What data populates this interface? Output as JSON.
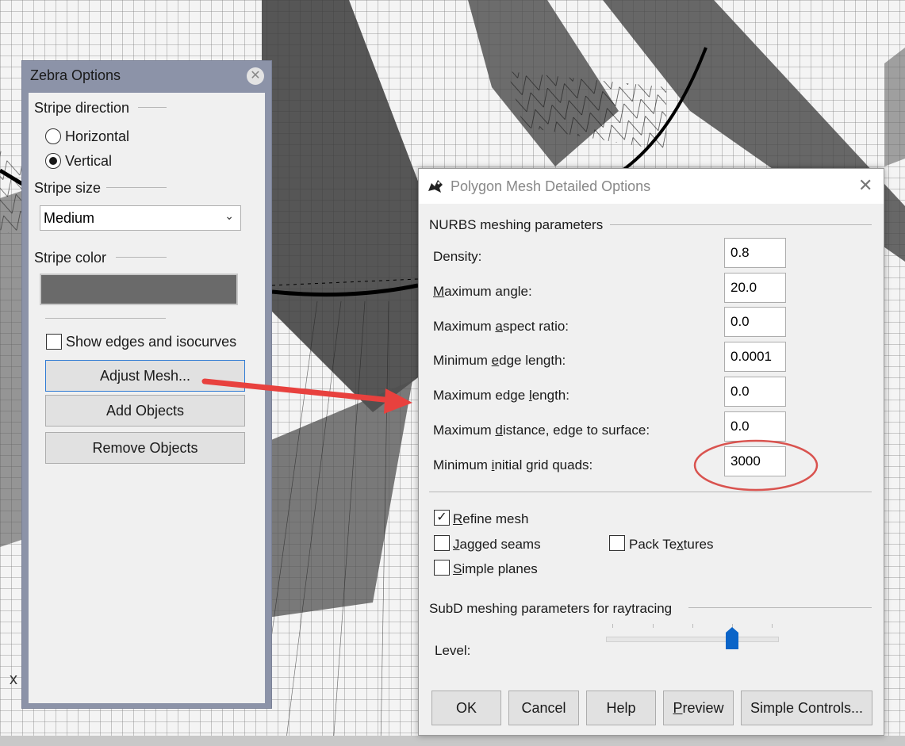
{
  "viewport": {
    "axis_label": "x"
  },
  "zebra": {
    "title": "Zebra Options",
    "stripe_direction": {
      "label": "Stripe direction",
      "options": [
        "Horizontal",
        "Vertical"
      ],
      "selected": "Vertical"
    },
    "stripe_size": {
      "label": "Stripe size",
      "value": "Medium"
    },
    "stripe_color": {
      "label": "Stripe color",
      "color": "#6a6a6a"
    },
    "show_edges": {
      "label": "Show edges and isocurves",
      "checked": false
    },
    "buttons": {
      "adjust_mesh": "Adjust Mesh...",
      "add_objects": "Add Objects",
      "remove_objects": "Remove Objects"
    }
  },
  "dialog": {
    "title": "Polygon Mesh Detailed Options",
    "nurbs_section": "NURBS meshing parameters",
    "params": [
      {
        "pre": "Density:",
        "key": "",
        "post": "",
        "value": "0.8"
      },
      {
        "pre": "",
        "key": "M",
        "post": "aximum angle:",
        "value": "20.0"
      },
      {
        "pre": "Maximum ",
        "key": "a",
        "post": "spect ratio:",
        "value": "0.0"
      },
      {
        "pre": "Minimum ",
        "key": "e",
        "post": "dge length:",
        "value": "0.0001"
      },
      {
        "pre": "Maximum edge ",
        "key": "l",
        "post": "ength:",
        "value": "0.0"
      },
      {
        "pre": "Maximum ",
        "key": "d",
        "post": "istance, edge to surface:",
        "value": "0.0"
      },
      {
        "pre": "Minimum ",
        "key": "i",
        "post": "nitial grid quads:",
        "value": "3000"
      }
    ],
    "options": {
      "refine_mesh": {
        "key": "R",
        "post": "efine mesh",
        "checked": true,
        "mark": "✓"
      },
      "jagged_seams": {
        "key": "J",
        "post": "agged seams",
        "checked": false
      },
      "simple_planes": {
        "key": "S",
        "post": "imple planes",
        "checked": false
      },
      "pack_textures": {
        "pre": "Pack Te",
        "key": "x",
        "post": "tures",
        "checked": false
      }
    },
    "subd_section": "SubD meshing parameters for raytracing",
    "level": {
      "label": "Level:",
      "value_fraction": 0.73
    },
    "buttons": {
      "ok": "OK",
      "cancel": "Cancel",
      "help": "Help",
      "preview": {
        "key": "P",
        "post": "review"
      },
      "simple_controls": "Simple Controls..."
    }
  },
  "annotation": {
    "highlight_color": "#d9534f",
    "arrow_color": "#e8413e"
  }
}
